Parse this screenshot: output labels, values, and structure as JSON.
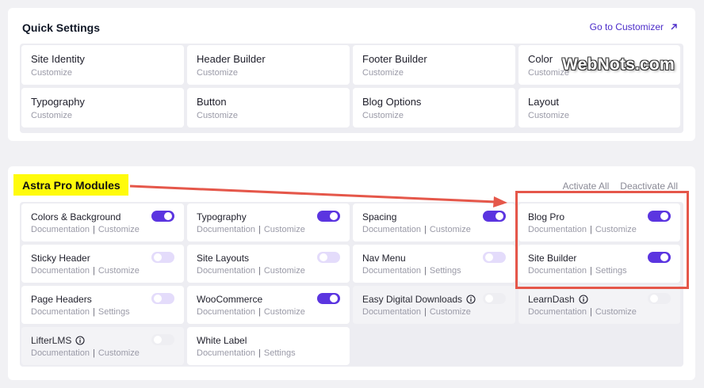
{
  "quick": {
    "title": "Quick Settings",
    "link": "Go to Customizer",
    "cards": [
      {
        "title": "Site Identity",
        "sub": "Customize"
      },
      {
        "title": "Header Builder",
        "sub": "Customize"
      },
      {
        "title": "Footer Builder",
        "sub": "Customize"
      },
      {
        "title": "Color",
        "sub": "Customize"
      },
      {
        "title": "Typography",
        "sub": "Customize"
      },
      {
        "title": "Button",
        "sub": "Customize"
      },
      {
        "title": "Blog Options",
        "sub": "Customize"
      },
      {
        "title": "Layout",
        "sub": "Customize"
      }
    ]
  },
  "pro": {
    "title": "Astra Pro Modules",
    "activate_all": "Activate All",
    "deactivate_all": "Deactivate All",
    "modules": [
      {
        "title": "Colors & Background",
        "doc": "Documentation",
        "action": "Customize",
        "toggle": "on",
        "info": false,
        "disabled": false
      },
      {
        "title": "Typography",
        "doc": "Documentation",
        "action": "Customize",
        "toggle": "on",
        "info": false,
        "disabled": false
      },
      {
        "title": "Spacing",
        "doc": "Documentation",
        "action": "Customize",
        "toggle": "on",
        "info": false,
        "disabled": false
      },
      {
        "title": "Blog Pro",
        "doc": "Documentation",
        "action": "Customize",
        "toggle": "on",
        "info": false,
        "disabled": false
      },
      {
        "title": "Sticky Header",
        "doc": "Documentation",
        "action": "Customize",
        "toggle": "off",
        "info": false,
        "disabled": false
      },
      {
        "title": "Site Layouts",
        "doc": "Documentation",
        "action": "Customize",
        "toggle": "off",
        "info": false,
        "disabled": false
      },
      {
        "title": "Nav Menu",
        "doc": "Documentation",
        "action": "Settings",
        "toggle": "off",
        "info": false,
        "disabled": false
      },
      {
        "title": "Site Builder",
        "doc": "Documentation",
        "action": "Settings",
        "toggle": "on",
        "info": false,
        "disabled": false
      },
      {
        "title": "Page Headers",
        "doc": "Documentation",
        "action": "Settings",
        "toggle": "off",
        "info": false,
        "disabled": false
      },
      {
        "title": "WooCommerce",
        "doc": "Documentation",
        "action": "Customize",
        "toggle": "on",
        "info": false,
        "disabled": false
      },
      {
        "title": "Easy Digital Downloads",
        "doc": "Documentation",
        "action": "Customize",
        "toggle": "dim",
        "info": true,
        "disabled": true
      },
      {
        "title": "LearnDash",
        "doc": "Documentation",
        "action": "Customize",
        "toggle": "dim",
        "info": true,
        "disabled": true
      },
      {
        "title": "LifterLMS",
        "doc": "Documentation",
        "action": "Customize",
        "toggle": "dim",
        "info": true,
        "disabled": true
      },
      {
        "title": "White Label",
        "doc": "Documentation",
        "action": "Settings",
        "toggle": "none",
        "info": false,
        "disabled": false
      }
    ]
  },
  "watermark": "WebNots.com",
  "colors": {
    "accent": "#5b35e0",
    "highlight": "#fffb0b",
    "annotation": "#e5574a"
  }
}
